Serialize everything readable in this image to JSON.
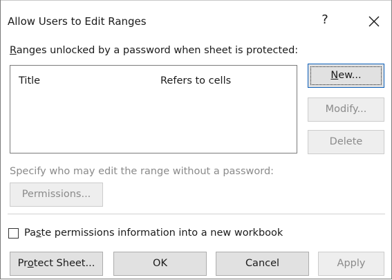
{
  "dialog": {
    "title": "Allow Users to Edit Ranges",
    "help_glyph": "?",
    "close_glyph": "×"
  },
  "ranges": {
    "label_mnemonic": "R",
    "label_rest": "anges unlocked by a password when sheet is protected:",
    "columns": [
      "Title",
      "Refers to cells"
    ],
    "rows": []
  },
  "buttons": {
    "new_mnemonic": "N",
    "new_rest": "ew...",
    "modify": "Modify...",
    "delete": "Delete",
    "permissions": "Permissions...",
    "protect_pre": "Pr",
    "protect_mnemonic": "o",
    "protect_rest": "tect Sheet...",
    "ok": "OK",
    "cancel": "Cancel",
    "apply": "Apply"
  },
  "permissions": {
    "label": "Specify who may edit the range without a password:"
  },
  "paste_option": {
    "pre": "Pa",
    "mnemonic": "s",
    "rest": "te permissions information into a new workbook",
    "checked": false
  },
  "colors": {
    "disabled_text": "#8a8a8a",
    "button_face": "#e1e1e1",
    "default_border": "#0a5db8"
  }
}
